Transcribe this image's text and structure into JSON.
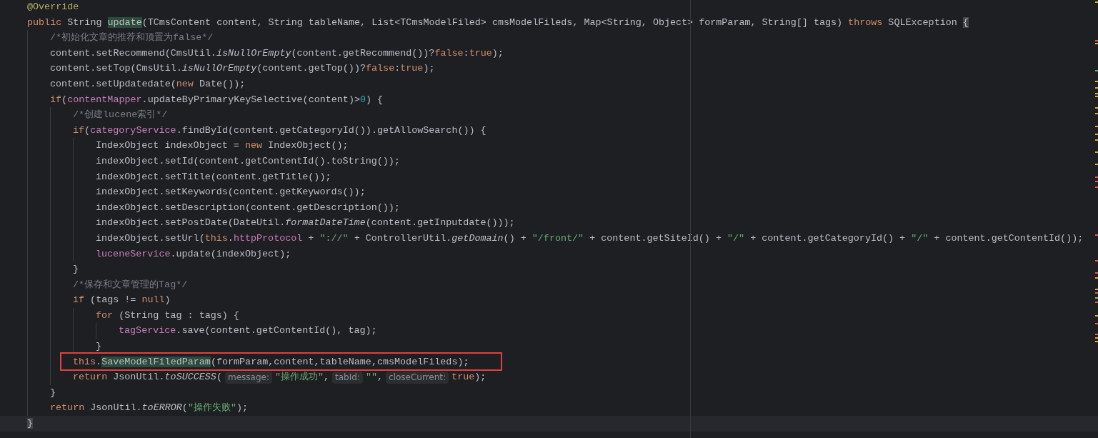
{
  "editor": {
    "lines": [
      {
        "tokens": [
          {
            "kind": "annotation",
            "text": "@Override"
          }
        ]
      },
      {
        "tokens": [
          {
            "kind": "keyword",
            "text": "public "
          },
          {
            "kind": "plain",
            "text": "String "
          },
          {
            "kind": "usage",
            "text": "update"
          },
          {
            "kind": "plain",
            "text": "(TCmsContent content, String tableName, List<TCmsModelFiled> cmsModelFileds, Map<String, Object> formParam, String[] tags) "
          },
          {
            "kind": "keyword",
            "text": "throws "
          },
          {
            "kind": "plain",
            "text": "SQLException "
          },
          {
            "kind": "brace",
            "text": "{"
          }
        ],
        "children": [
          {
            "tokens": [
              {
                "kind": "comment",
                "text": "/*初始化文章的推荐和顶置为false*/"
              }
            ]
          },
          {
            "tokens": [
              {
                "kind": "plain",
                "text": "content.setRecommend(CmsUtil."
              },
              {
                "kind": "italic",
                "text": "isNullOrEmpty"
              },
              {
                "kind": "plain",
                "text": "(content.getRecommend())?"
              },
              {
                "kind": "keyword",
                "text": "false"
              },
              {
                "kind": "plain",
                "text": ":"
              },
              {
                "kind": "keyword",
                "text": "true"
              },
              {
                "kind": "plain",
                "text": ");"
              }
            ]
          },
          {
            "tokens": [
              {
                "kind": "plain",
                "text": "content.setTop(CmsUtil."
              },
              {
                "kind": "italic",
                "text": "isNullOrEmpty"
              },
              {
                "kind": "plain",
                "text": "(content.getTop())?"
              },
              {
                "kind": "keyword",
                "text": "false"
              },
              {
                "kind": "plain",
                "text": ":"
              },
              {
                "kind": "keyword",
                "text": "true"
              },
              {
                "kind": "plain",
                "text": ");"
              }
            ]
          },
          {
            "tokens": [
              {
                "kind": "plain",
                "text": "content.setUpdatedate("
              },
              {
                "kind": "keyword",
                "text": "new "
              },
              {
                "kind": "plain",
                "text": "Date());"
              }
            ]
          },
          {
            "tokens": [
              {
                "kind": "keyword",
                "text": "if"
              },
              {
                "kind": "plain",
                "text": "("
              },
              {
                "kind": "field",
                "text": "contentMapper"
              },
              {
                "kind": "plain",
                "text": ".updateByPrimaryKeySelective(content)>"
              },
              {
                "kind": "number",
                "text": "0"
              },
              {
                "kind": "plain",
                "text": ") {"
              }
            ],
            "children": [
              {
                "tokens": [
                  {
                    "kind": "comment",
                    "text": "/*创建lucene索引*/"
                  }
                ]
              },
              {
                "tokens": [
                  {
                    "kind": "keyword",
                    "text": "if"
                  },
                  {
                    "kind": "plain",
                    "text": "("
                  },
                  {
                    "kind": "field",
                    "text": "categoryService"
                  },
                  {
                    "kind": "plain",
                    "text": ".findById(content.getCategoryId()).getAllowSearch()) {"
                  }
                ],
                "children": [
                  {
                    "tokens": [
                      {
                        "kind": "plain",
                        "text": "IndexObject indexObject = "
                      },
                      {
                        "kind": "keyword",
                        "text": "new "
                      },
                      {
                        "kind": "plain",
                        "text": "IndexObject();"
                      }
                    ]
                  },
                  {
                    "tokens": [
                      {
                        "kind": "plain",
                        "text": "indexObject.setId(content.getContentId().toString());"
                      }
                    ]
                  },
                  {
                    "tokens": [
                      {
                        "kind": "plain",
                        "text": "indexObject.setTitle(content.getTitle());"
                      }
                    ]
                  },
                  {
                    "tokens": [
                      {
                        "kind": "plain",
                        "text": "indexObject.setKeywords(content.getKeywords());"
                      }
                    ]
                  },
                  {
                    "tokens": [
                      {
                        "kind": "plain",
                        "text": "indexObject.setDescription(content.getDescription());"
                      }
                    ]
                  },
                  {
                    "tokens": [
                      {
                        "kind": "plain",
                        "text": "indexObject.setPostDate(DateUtil."
                      },
                      {
                        "kind": "italic",
                        "text": "formatDateTime"
                      },
                      {
                        "kind": "plain",
                        "text": "(content.getInputdate()));"
                      }
                    ]
                  },
                  {
                    "tokens": [
                      {
                        "kind": "plain",
                        "text": "indexObject.setUrl("
                      },
                      {
                        "kind": "keyword",
                        "text": "this"
                      },
                      {
                        "kind": "plain",
                        "text": "."
                      },
                      {
                        "kind": "field",
                        "text": "httpProtocol"
                      },
                      {
                        "kind": "plain",
                        "text": " + "
                      },
                      {
                        "kind": "string",
                        "text": "\"://\""
                      },
                      {
                        "kind": "plain",
                        "text": " + ControllerUtil."
                      },
                      {
                        "kind": "italic",
                        "text": "getDomain"
                      },
                      {
                        "kind": "plain",
                        "text": "() + "
                      },
                      {
                        "kind": "string",
                        "text": "\"/front/\""
                      },
                      {
                        "kind": "plain",
                        "text": " + content.getSiteId() + "
                      },
                      {
                        "kind": "string",
                        "text": "\"/\""
                      },
                      {
                        "kind": "plain",
                        "text": " + content.getCategoryId() + "
                      },
                      {
                        "kind": "string",
                        "text": "\"/\""
                      },
                      {
                        "kind": "plain",
                        "text": " + content.getContentId());"
                      }
                    ]
                  },
                  {
                    "tokens": [
                      {
                        "kind": "field",
                        "text": "luceneService"
                      },
                      {
                        "kind": "plain",
                        "text": ".update(indexObject);"
                      }
                    ]
                  }
                ]
              },
              {
                "tokens": [
                  {
                    "kind": "plain",
                    "text": "}"
                  }
                ]
              },
              {
                "tokens": [
                  {
                    "kind": "comment",
                    "text": "/*保存和文章管理的Tag*/"
                  }
                ]
              },
              {
                "tokens": [
                  {
                    "kind": "keyword",
                    "text": "if "
                  },
                  {
                    "kind": "plain",
                    "text": "(tags != "
                  },
                  {
                    "kind": "keyword",
                    "text": "null"
                  },
                  {
                    "kind": "plain",
                    "text": ")"
                  }
                ],
                "children": [
                  {
                    "tokens": [
                      {
                        "kind": "keyword",
                        "text": "for "
                      },
                      {
                        "kind": "plain",
                        "text": "(String tag : tags) {"
                      }
                    ],
                    "children": [
                      {
                        "tokens": [
                          {
                            "kind": "field",
                            "text": "tagService"
                          },
                          {
                            "kind": "plain",
                            "text": ".save(content.getContentId(), tag);"
                          }
                        ]
                      }
                    ]
                  },
                  {
                    "tokens": [
                      {
                        "kind": "plain",
                        "text": "}"
                      }
                    ]
                  }
                ]
              },
              {
                "boxed": true,
                "tokens": [
                  {
                    "kind": "keyword",
                    "text": "this"
                  },
                  {
                    "kind": "plain",
                    "text": "."
                  },
                  {
                    "kind": "usage",
                    "text": "SaveModelFiledParam"
                  },
                  {
                    "kind": "plain",
                    "text": "(formParam,content,tableName,cmsModelFileds);"
                  }
                ]
              },
              {
                "tokens": [
                  {
                    "kind": "keyword",
                    "text": "return "
                  },
                  {
                    "kind": "plain",
                    "text": "JsonUtil."
                  },
                  {
                    "kind": "italic",
                    "text": "toSUCCESS"
                  },
                  {
                    "kind": "plain",
                    "text": "("
                  },
                  {
                    "kind": "hint",
                    "text": "message:"
                  },
                  {
                    "kind": "string",
                    "text": "\"操作成功\""
                  },
                  {
                    "kind": "plain",
                    "text": ","
                  },
                  {
                    "kind": "hint",
                    "text": "tabId:"
                  },
                  {
                    "kind": "string",
                    "text": "\"\""
                  },
                  {
                    "kind": "plain",
                    "text": ","
                  },
                  {
                    "kind": "hint",
                    "text": "closeCurrent:"
                  },
                  {
                    "kind": "keyword",
                    "text": "true"
                  },
                  {
                    "kind": "plain",
                    "text": ");"
                  }
                ]
              }
            ]
          },
          {
            "tokens": [
              {
                "kind": "plain",
                "text": "}"
              }
            ]
          },
          {
            "tokens": [
              {
                "kind": "keyword",
                "text": "return "
              },
              {
                "kind": "plain",
                "text": "JsonUtil."
              },
              {
                "kind": "italic",
                "text": "toERROR"
              },
              {
                "kind": "plain",
                "text": "("
              },
              {
                "kind": "string",
                "text": "\"操作失败\""
              },
              {
                "kind": "plain",
                "text": ");"
              }
            ]
          }
        ]
      },
      {
        "current": true,
        "tokens": [
          {
            "kind": "brace",
            "text": "}"
          }
        ]
      }
    ]
  }
}
